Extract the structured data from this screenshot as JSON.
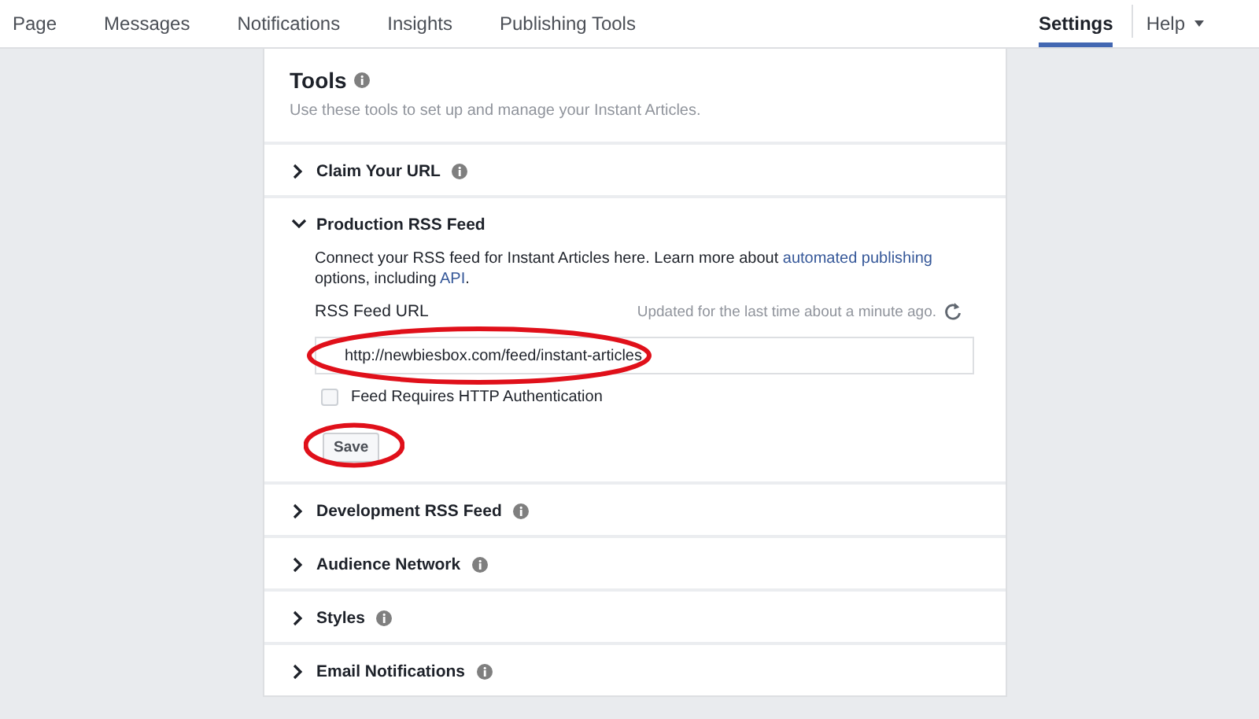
{
  "nav": {
    "items": [
      {
        "label": "Page",
        "selected": false
      },
      {
        "label": "Messages",
        "selected": false
      },
      {
        "label": "Notifications",
        "selected": false
      },
      {
        "label": "Insights",
        "selected": false
      },
      {
        "label": "Publishing Tools",
        "selected": false
      }
    ],
    "right_items": [
      {
        "label": "Settings",
        "selected": true,
        "dropdown": false
      },
      {
        "label": "Help",
        "selected": false,
        "dropdown": true
      }
    ]
  },
  "panel": {
    "title": "Tools",
    "subtitle": "Use these tools to set up and manage your Instant Articles.",
    "sections": [
      {
        "title": "Claim Your URL",
        "expanded": false,
        "info": true
      },
      {
        "title": "Production RSS Feed",
        "expanded": true,
        "info": false,
        "description": [
          {
            "text": "Connect your RSS feed for Instant Articles here. Learn more about ",
            "link": false
          },
          {
            "text": "automated publishing",
            "link": true
          },
          {
            "text": " options, including ",
            "link": false
          },
          {
            "text": "API",
            "link": true
          },
          {
            "text": ".",
            "link": false
          }
        ],
        "field_label": "RSS Feed URL",
        "status": "Updated for the last time about a minute ago.",
        "field": {
          "value": "http://newbiesbox.com/feed/instant-articles",
          "highlighted": true
        },
        "checkbox": {
          "label": "Feed Requires HTTP Authentication",
          "checked": false
        },
        "save": {
          "label": "Save",
          "highlighted": true
        }
      },
      {
        "title": "Development RSS Feed",
        "expanded": false,
        "info": true
      },
      {
        "title": "Audience Network",
        "expanded": false,
        "info": true
      },
      {
        "title": "Styles",
        "expanded": false,
        "info": true
      },
      {
        "title": "Email Notifications",
        "expanded": false,
        "info": true
      }
    ]
  }
}
